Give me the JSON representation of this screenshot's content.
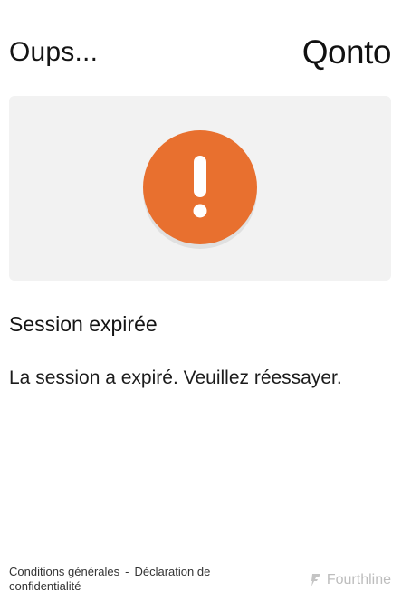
{
  "header": {
    "title": "Oups...",
    "logo": "Qonto"
  },
  "illustration": {
    "icon": "exclamation-icon",
    "accent_color": "#E8702F",
    "background_color": "#F2F2F2"
  },
  "content": {
    "heading": "Session expirée",
    "message": "La session a expiré. Veuillez réessayer."
  },
  "footer": {
    "terms_label": "Conditions générales",
    "separator": "-",
    "privacy_label": "Déclaration de confidentialité",
    "powered_by": "Fourthline",
    "powered_by_icon": "fourthline-logo-icon"
  }
}
